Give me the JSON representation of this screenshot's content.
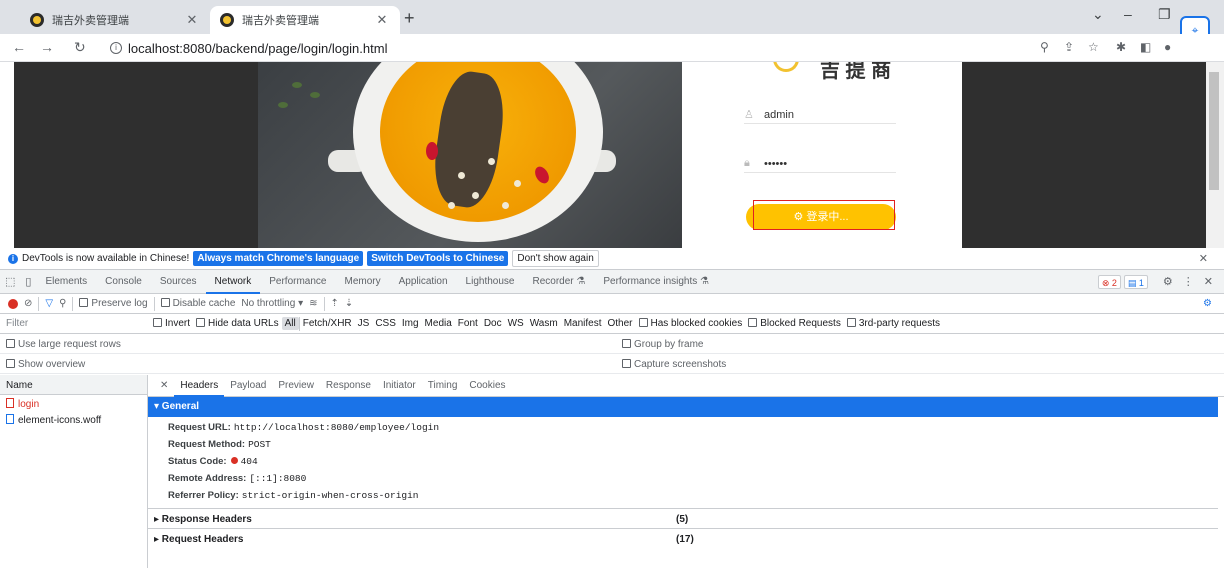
{
  "browser": {
    "tabs": [
      {
        "title": "瑞吉外卖管理端"
      },
      {
        "title": "瑞吉外卖管理端"
      }
    ],
    "url": "localhost:8080/backend/page/login/login.html"
  },
  "page": {
    "logo_text": "吉 提 商",
    "username_value": "admin",
    "password_value": "••••••",
    "login_button_label": "⚙ 登录中..."
  },
  "infobar": {
    "message": "DevTools is now available in Chinese!",
    "btn_match": "Always match Chrome's language",
    "btn_switch": "Switch DevTools to Chinese",
    "btn_dismiss": "Don't show again"
  },
  "devtools": {
    "tabs": [
      "Elements",
      "Console",
      "Sources",
      "Network",
      "Performance",
      "Memory",
      "Application",
      "Lighthouse",
      "Recorder ⚗",
      "Performance insights ⚗"
    ],
    "errors_badge": "⊗ 2",
    "issues_badge": "▤ 1"
  },
  "network_toolbar": {
    "preserve_log": "Preserve log",
    "disable_cache": "Disable cache",
    "throttling": "No throttling"
  },
  "filter": {
    "placeholder": "Filter",
    "invert": "Invert",
    "hide_data_urls": "Hide data URLs",
    "types": [
      "All",
      "Fetch/XHR",
      "JS",
      "CSS",
      "Img",
      "Media",
      "Font",
      "Doc",
      "WS",
      "Wasm",
      "Manifest",
      "Other"
    ],
    "has_blocked_cookies": "Has blocked cookies",
    "blocked_requests": "Blocked Requests",
    "third_party": "3rd-party requests"
  },
  "options": {
    "large_rows": "Use large request rows",
    "group_by_frame": "Group by frame",
    "show_overview": "Show overview",
    "capture_screenshots": "Capture screenshots"
  },
  "request_list": {
    "header": "Name",
    "items": [
      "login",
      "element-icons.woff"
    ]
  },
  "detail": {
    "tabs": [
      "Headers",
      "Payload",
      "Preview",
      "Response",
      "Initiator",
      "Timing",
      "Cookies"
    ],
    "general_title": "▾ General",
    "general": [
      {
        "key": "Request URL:",
        "value": "http://localhost:8080/employee/login"
      },
      {
        "key": "Request Method:",
        "value": "POST"
      },
      {
        "key": "Status Code:",
        "value": "404"
      },
      {
        "key": "Remote Address:",
        "value": "[::1]:8080"
      },
      {
        "key": "Referrer Policy:",
        "value": "strict-origin-when-cross-origin"
      }
    ],
    "response_headers": {
      "label": "▸ Response Headers",
      "count": "(5)"
    },
    "request_headers": {
      "label": "▸ Request Headers",
      "count": "(17)"
    }
  }
}
